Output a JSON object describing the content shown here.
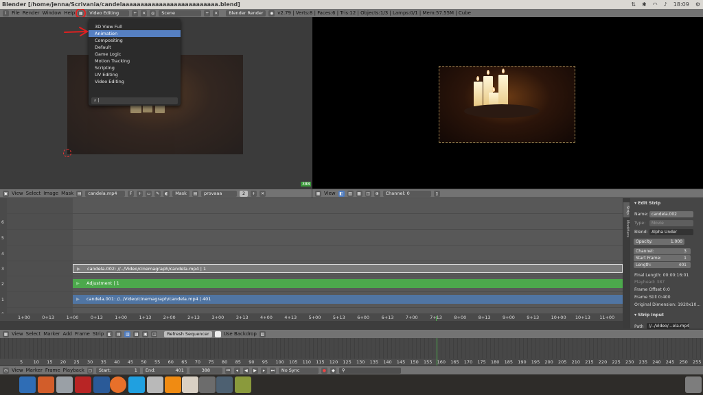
{
  "window_title": "Blender [/home/jenna/Scrivania/candelaaaaaaaaaaaaaaaaaaaaaaaaaa.blend]",
  "tray": {
    "clock": "18:09"
  },
  "info_header": {
    "menus": [
      "File",
      "Render",
      "Window",
      "Help"
    ],
    "screen_layout": "Video Editing",
    "scene": "Scene",
    "engine": "Blender Render",
    "stats": "v2.79 | Verts:8 | Faces:6 | Tris:12 | Objects:1/3 | Lamps:0/1 | Mem:57.55M | Cube"
  },
  "layout_menu": {
    "items": [
      "3D View Full",
      "Animation",
      "Compositing",
      "Default",
      "Game Logic",
      "Motion Tracking",
      "Scripting",
      "UV Editing",
      "Video Editing"
    ],
    "selected": "Animation"
  },
  "viewport": {
    "frame_badge": "388"
  },
  "image_header": {
    "menus": [
      "View",
      "Select",
      "Image",
      "Mask"
    ],
    "image_name": "candela.mp4",
    "mask_label": "Mask",
    "mask_name": "provaaa",
    "mask_users": "2",
    "f_label": "F"
  },
  "preview_header": {
    "menus": [
      "View"
    ],
    "channel_label": "Channel:",
    "channel_value": "0"
  },
  "sequencer": {
    "channel_numbers": [
      "6",
      "5",
      "4",
      "3",
      "2",
      "1",
      "0"
    ],
    "strips": [
      {
        "label": "candela.002: //../Video/cinemagraph/candela.mp4 | 1",
        "color": "#7a7a7a"
      },
      {
        "label": "Adjustment | 1",
        "color": "#4ca84c"
      },
      {
        "label": "candela.001: //../Video/cinemagraph/candela.mp4 | 401",
        "color": "#5075a3"
      }
    ],
    "ruler": [
      "1+00",
      "0+13",
      "1+00",
      "0+13",
      "1+00",
      "1+13",
      "2+00",
      "2+13",
      "3+00",
      "3+13",
      "4+00",
      "4+13",
      "5+00",
      "5+13",
      "6+00",
      "6+13",
      "7+00",
      "7+13",
      "8+00",
      "8+13",
      "9+00",
      "9+13",
      "10+00",
      "10+13",
      "11+00"
    ]
  },
  "sequencer_header": {
    "menus": [
      "View",
      "Select",
      "Marker",
      "Add",
      "Frame",
      "Strip"
    ],
    "refresh": "Refresh Sequencer",
    "backdrop": "Use Backdrop"
  },
  "properties": {
    "tabs": [
      "Strip",
      "Modifiers"
    ],
    "edit_strip_title": "Edit Strip",
    "name_label": "Name:",
    "name_value": "candela.002",
    "type_label": "Type:",
    "type_value": "Movie",
    "blend_label": "Blend:",
    "blend_value": "Alpha Under",
    "opacity_label": "Opacity:",
    "opacity_value": "1.000",
    "channel_label": "Channel:",
    "channel_value": "3",
    "start_label": "Start Frame:",
    "start_value": "1",
    "length_label": "Length:",
    "length_value": "401",
    "final_length": "Final Length: 00:00:16:01",
    "playhead": "Playhead: 387",
    "frame_offset": "Frame Offset 0:0",
    "frame_still": "Frame Still 0:400",
    "original_dim": "Original Dimension: 1920x10…",
    "strip_input_title": "Strip Input",
    "path_label": "Path",
    "path_value": "//../Video/…ela.mp4"
  },
  "timeline": {
    "ticks": [
      "5",
      "10",
      "15",
      "20",
      "25",
      "30",
      "35",
      "40",
      "45",
      "50",
      "55",
      "60",
      "65",
      "70",
      "75",
      "80",
      "85",
      "90",
      "95",
      "100",
      "105",
      "110",
      "115",
      "120",
      "125",
      "130",
      "135",
      "140",
      "145",
      "150",
      "155",
      "160",
      "165",
      "170",
      "175",
      "180",
      "185",
      "190",
      "195",
      "200",
      "205",
      "210",
      "215",
      "220",
      "225",
      "230",
      "235",
      "240",
      "245",
      "250",
      "255"
    ]
  },
  "timeline_header": {
    "menus": [
      "View",
      "Marker",
      "Frame",
      "Playback"
    ],
    "start_label": "Start:",
    "start_value": "1",
    "end_label": "End:",
    "end_value": "401",
    "current": "388",
    "sync": "No Sync"
  },
  "colors": {
    "accent": "#5680c2",
    "annotation": "#e02020"
  }
}
